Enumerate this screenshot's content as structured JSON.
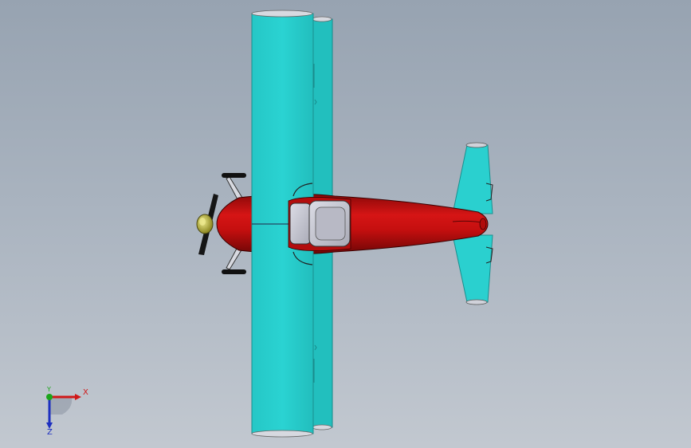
{
  "viewport": {
    "background_top": "#97a3b1",
    "background_bottom": "#c2c8d0"
  },
  "model": {
    "wing_color": "#2ad0cf",
    "fuselage_color": "#c40f0f",
    "seat_color": "#c9cad5",
    "propeller_color": "#1a1a1a",
    "spinner_color": "#c8c23a"
  },
  "triad": {
    "x_label": "X",
    "y_label": "Y",
    "z_label": "Z",
    "x_color": "#d01818",
    "y_color": "#1aa51a",
    "z_color": "#1d2fc0"
  }
}
